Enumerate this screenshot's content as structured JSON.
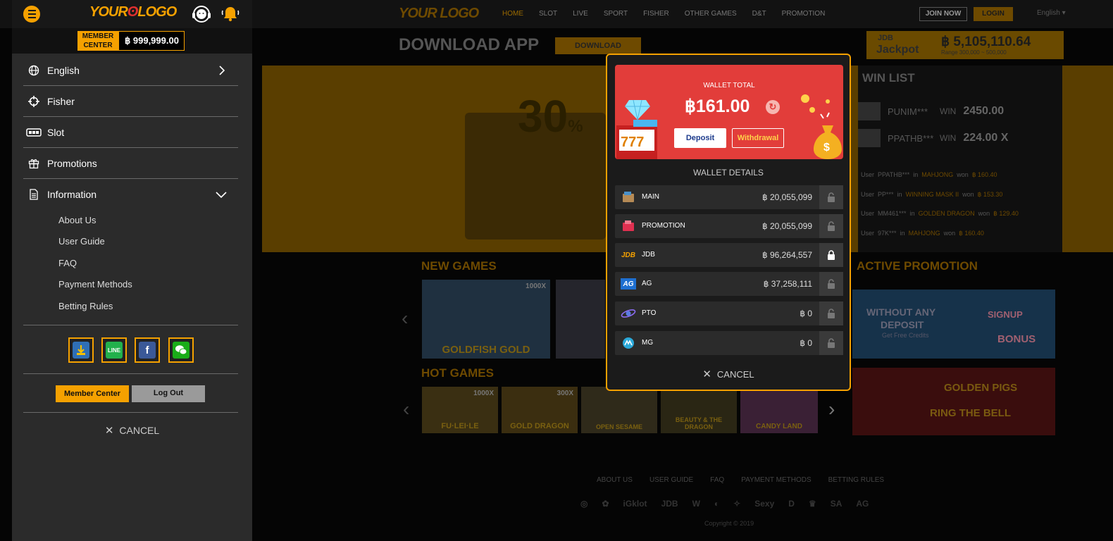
{
  "site": {
    "logo": "YOUR LOGO",
    "nav": [
      "HOME",
      "SLOT",
      "LIVE",
      "SPORT",
      "FISHER",
      "OTHER GAMES",
      "D&T",
      "PROMOTION"
    ],
    "join_label": "JOIN NOW",
    "login_label": "LOGIN",
    "language": "English ▾",
    "download_title": "DOWNLOAD APP",
    "download_btn": "DOWNLOAD",
    "jackpot": {
      "brand": "JDB",
      "label": "Jackpot",
      "amount": "฿ 5,105,110.64",
      "range": "Range 300,000 ~ 500,000"
    },
    "banner": {
      "big": "30",
      "pct": "%"
    },
    "new_games_title": "NEW GAMES",
    "new_games": [
      {
        "name": "GOLDFISH GOLD",
        "tag": "1000X"
      },
      {
        "name": "",
        "tag": ""
      }
    ],
    "hot_games_title": "HOT GAMES",
    "hot_games": [
      {
        "name": "FU·LEI·LE",
        "tag": "1000X"
      },
      {
        "name": "GOLD DRAGON",
        "tag": "300X"
      },
      {
        "name": "OPEN SESAME",
        "tag": ""
      },
      {
        "name": "BEAUTY & THE DRAGON",
        "tag": ""
      },
      {
        "name": "CANDY LAND",
        "tag": ""
      }
    ],
    "win_list_title": "WIN LIST",
    "win_list": [
      {
        "user": "PUNIM***",
        "win": "WIN",
        "value": "2450.00"
      },
      {
        "user": "PPATHB***",
        "win": "WIN",
        "value": "224.00 X"
      }
    ],
    "feed": [
      {
        "user": "PPATHB***",
        "game": "MAHJONG",
        "amount": "฿ 160.40"
      },
      {
        "user": "PP***",
        "game": "WINNING MASK II",
        "amount": "฿ 153.30"
      },
      {
        "user": "MM461***",
        "game": "GOLDEN DRAGON",
        "amount": "฿ 129.40"
      },
      {
        "user": "97K***",
        "game": "MAHJONG",
        "amount": "฿ 160.40"
      }
    ],
    "feed_words": {
      "user": "User",
      "in": "in",
      "won": "won"
    },
    "active_promo_title": "ACTIVE PROMOTION",
    "promos": [
      {
        "line1": "WITHOUT ANY",
        "line2": "DEPOSIT",
        "line3": "Get Free Credits",
        "badge1": "SIGNUP",
        "badge2": "BONUS"
      },
      {
        "line1": "GOLDEN PIGS",
        "line2": "RING THE BELL"
      }
    ],
    "footer_links": [
      "ABOUT US",
      "USER GUIDE",
      "FAQ",
      "PAYMENT METHODS",
      "BETTING RULES"
    ],
    "providers": [
      "◎",
      "✿",
      "iGklot",
      "JDB",
      "W",
      "◐",
      "✧",
      "Sexy",
      "D",
      "♛",
      "SA",
      "AG"
    ],
    "copyright": "Copyright © 2019"
  },
  "drawer": {
    "logo_a": "YOUR",
    "logo_b": "LOGO",
    "member_center_tag": "MEMBER CENTER",
    "balance": "฿ 999,999.00",
    "items": [
      {
        "label": "English",
        "icon": "globe-icon"
      },
      {
        "label": "Fisher",
        "icon": "crosshair-icon"
      },
      {
        "label": "Slot",
        "icon": "slot-machine-icon"
      },
      {
        "label": "Promotions",
        "icon": "gift-icon"
      },
      {
        "label": "Information",
        "icon": "document-icon"
      }
    ],
    "sub_items": [
      "About Us",
      "User Guide",
      "FAQ",
      "Payment Methods",
      "Betting Rules"
    ],
    "social": [
      "download-icon",
      "line-icon",
      "facebook-icon",
      "wechat-icon"
    ],
    "member_center_btn": "Member Center",
    "logout_btn": "Log Out",
    "cancel": "CANCEL"
  },
  "wallet": {
    "total_label": "WALLET TOTAL",
    "total": "฿161.00",
    "deposit": "Deposit",
    "withdrawal": "Withdrawal",
    "details_title": "WALLET DETAILS",
    "rows": [
      {
        "name": "MAIN",
        "amount": "฿ 20,055,099",
        "icon": "wallet-icon",
        "locked": false
      },
      {
        "name": "PROMOTION",
        "amount": "฿ 20,055,099",
        "icon": "red-wallet-icon",
        "locked": false
      },
      {
        "name": "JDB",
        "amount": "฿ 96,264,557",
        "icon": "jdb-logo",
        "locked": true
      },
      {
        "name": "AG",
        "amount": "฿ 37,258,111",
        "icon": "ag-logo",
        "locked": false
      },
      {
        "name": "PTO",
        "amount": "฿ 0",
        "icon": "pto-logo",
        "locked": false
      },
      {
        "name": "MG",
        "amount": "฿ 0",
        "icon": "mg-logo",
        "locked": false
      }
    ],
    "cancel": "CANCEL"
  },
  "colors": {
    "accent": "#f5a100",
    "wallet_red": "#e23d3a",
    "drawer_bg": "#2b2b2b"
  }
}
